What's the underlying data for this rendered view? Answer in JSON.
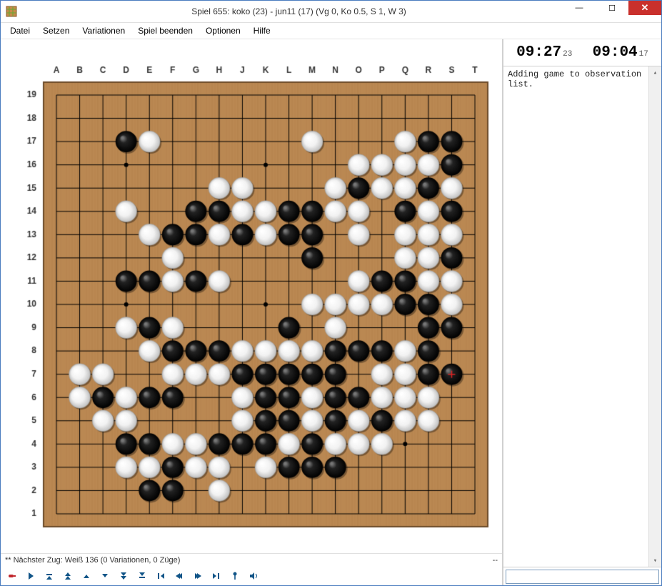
{
  "title": "Spiel 655: koko (23) - jun11 (17) (Vg 0, Ko 0.5, S 1, W 3)",
  "menu": [
    "Datei",
    "Setzen",
    "Variationen",
    "Spiel beenden",
    "Optionen",
    "Hilfe"
  ],
  "status_left": "** Nächster Zug: Weiß 136 (0 Variationen, 0 Züge)",
  "status_right": "--",
  "clocks": {
    "left_main": "09:27",
    "left_sub": "23",
    "right_main": "09:04",
    "right_sub": "17"
  },
  "log_text": "Adding game to observation list.",
  "chat_value": "",
  "board": {
    "size": 19,
    "col_labels": [
      "A",
      "B",
      "C",
      "D",
      "E",
      "F",
      "G",
      "H",
      "J",
      "K",
      "L",
      "M",
      "N",
      "O",
      "P",
      "Q",
      "R",
      "S",
      "T"
    ],
    "star_points": [
      [
        4,
        4
      ],
      [
        4,
        10
      ],
      [
        4,
        16
      ],
      [
        10,
        4
      ],
      [
        10,
        10
      ],
      [
        10,
        16
      ],
      [
        16,
        4
      ],
      [
        16,
        10
      ],
      [
        16,
        16
      ]
    ],
    "last_move": [
      18,
      7
    ],
    "stones": {
      "black": [
        [
          4,
          17
        ],
        [
          17,
          17
        ],
        [
          18,
          17
        ],
        [
          18,
          16
        ],
        [
          14,
          15
        ],
        [
          17,
          15
        ],
        [
          7,
          14
        ],
        [
          8,
          14
        ],
        [
          11,
          14
        ],
        [
          12,
          14
        ],
        [
          16,
          14
        ],
        [
          18,
          14
        ],
        [
          6,
          13
        ],
        [
          7,
          13
        ],
        [
          9,
          13
        ],
        [
          11,
          13
        ],
        [
          12,
          13
        ],
        [
          12,
          12
        ],
        [
          18,
          12
        ],
        [
          4,
          11
        ],
        [
          5,
          11
        ],
        [
          7,
          11
        ],
        [
          15,
          11
        ],
        [
          16,
          11
        ],
        [
          16,
          10
        ],
        [
          17,
          10
        ],
        [
          5,
          9
        ],
        [
          11,
          9
        ],
        [
          17,
          9
        ],
        [
          18,
          9
        ],
        [
          6,
          8
        ],
        [
          7,
          8
        ],
        [
          8,
          8
        ],
        [
          13,
          8
        ],
        [
          14,
          8
        ],
        [
          15,
          8
        ],
        [
          17,
          8
        ],
        [
          9,
          7
        ],
        [
          10,
          7
        ],
        [
          11,
          7
        ],
        [
          12,
          7
        ],
        [
          13,
          7
        ],
        [
          17,
          7
        ],
        [
          18,
          7
        ],
        [
          3,
          6
        ],
        [
          5,
          6
        ],
        [
          6,
          6
        ],
        [
          10,
          6
        ],
        [
          11,
          6
        ],
        [
          13,
          6
        ],
        [
          14,
          6
        ],
        [
          10,
          5
        ],
        [
          11,
          5
        ],
        [
          13,
          5
        ],
        [
          15,
          5
        ],
        [
          4,
          4
        ],
        [
          5,
          4
        ],
        [
          8,
          4
        ],
        [
          9,
          4
        ],
        [
          10,
          4
        ],
        [
          12,
          4
        ],
        [
          6,
          3
        ],
        [
          11,
          3
        ],
        [
          12,
          3
        ],
        [
          13,
          3
        ],
        [
          5,
          2
        ],
        [
          6,
          2
        ]
      ],
      "white": [
        [
          5,
          17
        ],
        [
          12,
          17
        ],
        [
          16,
          17
        ],
        [
          14,
          16
        ],
        [
          15,
          16
        ],
        [
          16,
          16
        ],
        [
          17,
          16
        ],
        [
          8,
          15
        ],
        [
          9,
          15
        ],
        [
          13,
          15
        ],
        [
          15,
          15
        ],
        [
          16,
          15
        ],
        [
          18,
          15
        ],
        [
          4,
          14
        ],
        [
          9,
          14
        ],
        [
          10,
          14
        ],
        [
          13,
          14
        ],
        [
          14,
          14
        ],
        [
          17,
          14
        ],
        [
          5,
          13
        ],
        [
          8,
          13
        ],
        [
          10,
          13
        ],
        [
          14,
          13
        ],
        [
          16,
          13
        ],
        [
          17,
          13
        ],
        [
          18,
          13
        ],
        [
          6,
          12
        ],
        [
          16,
          12
        ],
        [
          17,
          12
        ],
        [
          6,
          11
        ],
        [
          8,
          11
        ],
        [
          14,
          11
        ],
        [
          17,
          11
        ],
        [
          18,
          11
        ],
        [
          12,
          10
        ],
        [
          13,
          10
        ],
        [
          14,
          10
        ],
        [
          15,
          10
        ],
        [
          18,
          10
        ],
        [
          4,
          9
        ],
        [
          6,
          9
        ],
        [
          13,
          9
        ],
        [
          5,
          8
        ],
        [
          9,
          8
        ],
        [
          10,
          8
        ],
        [
          11,
          8
        ],
        [
          12,
          8
        ],
        [
          16,
          8
        ],
        [
          2,
          7
        ],
        [
          3,
          7
        ],
        [
          6,
          7
        ],
        [
          7,
          7
        ],
        [
          8,
          7
        ],
        [
          15,
          7
        ],
        [
          16,
          7
        ],
        [
          2,
          6
        ],
        [
          4,
          6
        ],
        [
          9,
          6
        ],
        [
          12,
          6
        ],
        [
          15,
          6
        ],
        [
          16,
          6
        ],
        [
          17,
          6
        ],
        [
          3,
          5
        ],
        [
          4,
          5
        ],
        [
          9,
          5
        ],
        [
          12,
          5
        ],
        [
          14,
          5
        ],
        [
          16,
          5
        ],
        [
          17,
          5
        ],
        [
          6,
          4
        ],
        [
          7,
          4
        ],
        [
          11,
          4
        ],
        [
          13,
          4
        ],
        [
          14,
          4
        ],
        [
          15,
          4
        ],
        [
          4,
          3
        ],
        [
          5,
          3
        ],
        [
          7,
          3
        ],
        [
          8,
          3
        ],
        [
          10,
          3
        ],
        [
          8,
          2
        ]
      ]
    }
  },
  "toolbar_icons": [
    "record",
    "play",
    "first",
    "back-fast",
    "back",
    "down",
    "down-fast",
    "down-all",
    "nav-first",
    "nav-prev",
    "nav-next",
    "nav-last",
    "pin",
    "sound"
  ]
}
